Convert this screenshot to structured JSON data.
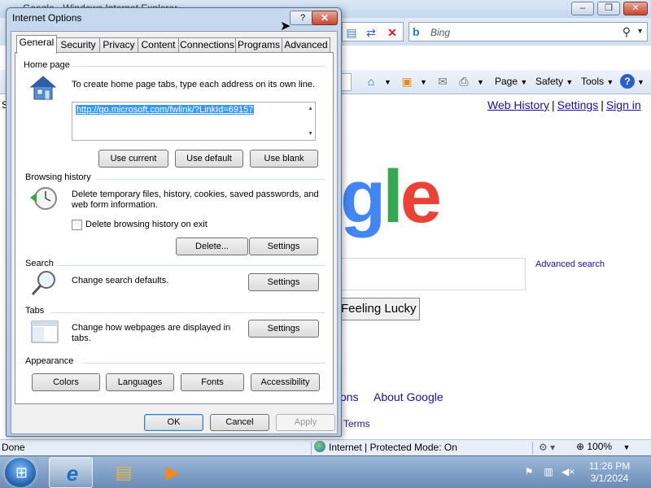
{
  "browser": {
    "window_title": "Google - Windows Internet Explorer",
    "search_provider_placeholder": "Bing",
    "command_bar": {
      "page_label": "Page",
      "safety_label": "Safety",
      "tools_label": "Tools"
    },
    "page": {
      "left_cut_text": "S",
      "top_links": [
        "Web History",
        "Settings",
        "Sign in"
      ],
      "logo_fragment": [
        "g",
        "l",
        "e"
      ],
      "advanced_search": "Advanced search",
      "lucky_button": "Feeling Lucky",
      "ions_link": "ons",
      "about_link": "About Google",
      "terms_link": "Terms"
    },
    "status": {
      "left": "Done",
      "zone": "Internet | Protected Mode: On",
      "zoom": "100%"
    }
  },
  "taskbar": {
    "clock_time": "11:26 PM",
    "clock_date": "3/1/2024"
  },
  "dialog": {
    "title": "Internet Options",
    "help_label": "?",
    "close_label": "✕",
    "tabs": [
      "General",
      "Security",
      "Privacy",
      "Content",
      "Connections",
      "Programs",
      "Advanced"
    ],
    "active_tab": "General",
    "home_page": {
      "title": "Home page",
      "description": "To create home page tabs, type each address on its own line.",
      "url": "http://go.microsoft.com/fwlink/?LinkId=69157",
      "use_current": "Use current",
      "use_default": "Use default",
      "use_blank": "Use blank"
    },
    "browsing_history": {
      "title": "Browsing history",
      "description": "Delete temporary files, history, cookies, saved passwords, and web form information.",
      "checkbox_label": "Delete browsing history on exit",
      "checkbox_checked": false,
      "delete_button": "Delete...",
      "settings_button": "Settings"
    },
    "search": {
      "title": "Search",
      "description": "Change search defaults.",
      "settings_button": "Settings"
    },
    "tabs_section": {
      "title": "Tabs",
      "description": "Change how webpages are displayed in tabs.",
      "settings_button": "Settings"
    },
    "appearance": {
      "title": "Appearance",
      "colors": "Colors",
      "languages": "Languages",
      "fonts": "Fonts",
      "accessibility": "Accessibility"
    },
    "footer": {
      "ok": "OK",
      "cancel": "Cancel",
      "apply": "Apply"
    }
  },
  "colors": {
    "link": "#1a0dab",
    "selection": "#3399ff",
    "google_blue": "#4285f4",
    "google_green": "#34a853",
    "google_red": "#ea4335"
  }
}
